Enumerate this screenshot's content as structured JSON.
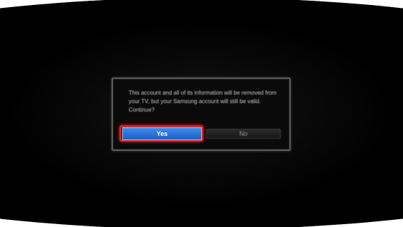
{
  "dialog": {
    "message": "This account and all of its information will be removed from your TV, but your Samsung account will still be valid. Continue?",
    "yes_label": "Yes",
    "no_label": "No",
    "focused_button": "Yes"
  },
  "colors": {
    "screen_background": "#000000",
    "yes_button": "#2a72d8",
    "focus_highlight": "#e02020",
    "no_button": "#1f1f1f"
  }
}
